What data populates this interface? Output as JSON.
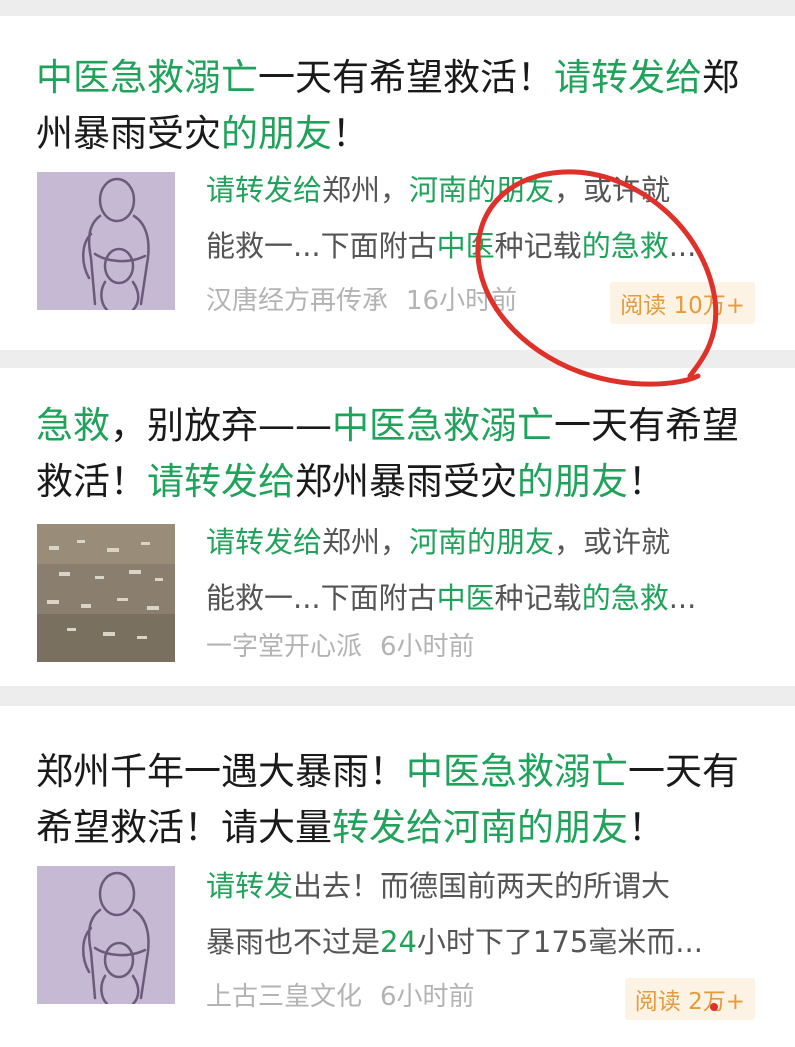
{
  "articles": [
    {
      "title_parts": [
        {
          "text": "中医急救溺亡",
          "hl": true
        },
        {
          "text": "一天有希望救活！",
          "hl": false
        },
        {
          "text": "请转发给",
          "hl": true
        },
        {
          "text": "郑州暴雨受灾",
          "hl": false
        },
        {
          "text": "的朋友",
          "hl": true
        },
        {
          "text": "！",
          "hl": false
        }
      ],
      "snippet_lines": [
        [
          {
            "text": "请转发给",
            "hl": true
          },
          {
            "text": "郑州，",
            "hl": false
          },
          {
            "text": "河南的朋友",
            "hl": true
          },
          {
            "text": "，或许就",
            "hl": false
          }
        ],
        [
          {
            "text": "能救一...下面附古",
            "hl": false
          },
          {
            "text": "中医",
            "hl": true
          },
          {
            "text": "种记载",
            "hl": false
          },
          {
            "text": "的急救",
            "hl": true
          },
          {
            "text": "...",
            "hl": false
          }
        ]
      ],
      "source": "汉唐经方再传承",
      "time": "16小时前",
      "read_count": "阅读 10万+",
      "thumb_icon": "guardian-with-child-sketch-icon"
    },
    {
      "title_parts": [
        {
          "text": "急救",
          "hl": true
        },
        {
          "text": "，别放弃——",
          "hl": false
        },
        {
          "text": "中医急救溺亡",
          "hl": true
        },
        {
          "text": "一天有希望救活！",
          "hl": false
        },
        {
          "text": "请转发给",
          "hl": true
        },
        {
          "text": "郑州暴雨受灾",
          "hl": false
        },
        {
          "text": "的朋友",
          "hl": true
        },
        {
          "text": "！",
          "hl": false
        }
      ],
      "snippet_lines": [
        [
          {
            "text": "请转发给",
            "hl": true
          },
          {
            "text": "郑州，",
            "hl": false
          },
          {
            "text": "河南的朋友",
            "hl": true
          },
          {
            "text": "，或许就",
            "hl": false
          }
        ],
        [
          {
            "text": "能救一...下面附古",
            "hl": false
          },
          {
            "text": "中医",
            "hl": true
          },
          {
            "text": "种记载",
            "hl": false
          },
          {
            "text": "的急救",
            "hl": true
          },
          {
            "text": "...",
            "hl": false
          }
        ]
      ],
      "source": "一字堂开心派",
      "time": "6小时前",
      "read_count": "",
      "thumb_icon": "flooded-street-photo-icon"
    },
    {
      "title_parts": [
        {
          "text": "郑州千年一遇大暴雨！",
          "hl": false
        },
        {
          "text": "中医急救溺亡",
          "hl": true
        },
        {
          "text": "一天有希望救活！请大量",
          "hl": false
        },
        {
          "text": "转发给河南的朋友",
          "hl": true
        },
        {
          "text": "！",
          "hl": false
        }
      ],
      "snippet_lines": [
        [
          {
            "text": "请转发",
            "hl": true
          },
          {
            "text": "出去！而德国前两天的所谓大",
            "hl": false
          }
        ],
        [
          {
            "text": "暴雨也不过是",
            "hl": false
          },
          {
            "text": "24",
            "hl": true
          },
          {
            "text": "小时下了175毫米而...",
            "hl": false
          }
        ]
      ],
      "source": "上古三皇文化",
      "time": "6小时前",
      "read_count": "阅读 2万+",
      "thumb_icon": "guardian-with-child-sketch-icon"
    }
  ],
  "colors": {
    "highlight": "#1fa35a",
    "body_text": "#1a1a1a",
    "snippet_text": "#555555",
    "meta_text": "#b3b3b3",
    "badge_text": "#e79a3a",
    "badge_bg": "#fdf3e4",
    "annotation": "#e0302a"
  }
}
